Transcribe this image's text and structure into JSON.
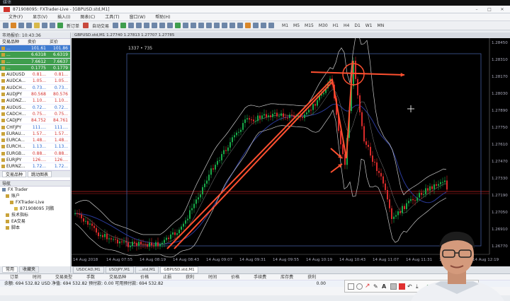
{
  "top_strip": {
    "label": "媒体"
  },
  "window": {
    "title": "871908095: FXTrader-Live - [GBPUSD.std,M1]",
    "minimize": "–",
    "maximize": "□",
    "close": "✕"
  },
  "menu": [
    "文件(F)",
    "显示(V)",
    "插入(I)",
    "图表(C)",
    "工具(T)",
    "窗口(W)",
    "帮助(H)"
  ],
  "toolbar": {
    "new_order": "新订单",
    "auto_trading": "自动交易"
  },
  "market_watch": {
    "title": "市场报价: 10:43:36",
    "col_symbol": "交易品种",
    "col_bid": "卖价",
    "col_ask": "买价",
    "rows": [
      {
        "symbol": "...",
        "bid": "101.61",
        "ask": "101.86",
        "style": "hl"
      },
      {
        "symbol": "...",
        "bid": "6.6318",
        "ask": "6.6319",
        "style": "gr"
      },
      {
        "symbol": "...",
        "bid": "7.6612",
        "ask": "7.6637",
        "style": "gr"
      },
      {
        "symbol": "...",
        "bid": "0.1775",
        "ask": "0.1779",
        "style": "gr"
      },
      {
        "symbol": "AUDUSD",
        "bid": "0.81...",
        "ask": "0.81...",
        "style": ""
      },
      {
        "symbol": "AUDCA...",
        "bid": "1.05...",
        "ask": "1.05...",
        "style": ""
      },
      {
        "symbol": "AUDCH...",
        "bid": "0.73...",
        "ask": "0.73...",
        "style": ""
      },
      {
        "symbol": "AUDJPY",
        "bid": "80.568",
        "ask": "80.576",
        "style": ""
      },
      {
        "symbol": "AUDNZ...",
        "bid": "1.10...",
        "ask": "1.10...",
        "style": ""
      },
      {
        "symbol": "AUDUS...",
        "bid": "0.72...",
        "ask": "0.72...",
        "style": ""
      },
      {
        "symbol": "CADCH...",
        "bid": "0.75...",
        "ask": "0.75...",
        "style": ""
      },
      {
        "symbol": "CADJPY",
        "bid": "84.752",
        "ask": "84.761",
        "style": ""
      },
      {
        "symbol": "CHFJPY",
        "bid": "111....",
        "ask": "111....",
        "style": ""
      },
      {
        "symbol": "EURAU...",
        "bid": "1.57...",
        "ask": "1.57...",
        "style": ""
      },
      {
        "symbol": "EURCA...",
        "bid": "1.48...",
        "ask": "1.48...",
        "style": ""
      },
      {
        "symbol": "EURCH...",
        "bid": "1.13...",
        "ask": "1.13...",
        "style": ""
      },
      {
        "symbol": "EURGB...",
        "bid": "0.88...",
        "ask": "0.88...",
        "style": ""
      },
      {
        "symbol": "EURJPY",
        "bid": "126....",
        "ask": "126....",
        "style": ""
      },
      {
        "symbol": "EURNZ...",
        "bid": "1.72...",
        "ask": "1.72...",
        "style": ""
      }
    ],
    "tab1": "交易品种",
    "tab2": "跳动图表"
  },
  "navigator": {
    "title": "导航",
    "items": [
      "FX Trader",
      "账户",
      "FXTrader-Live",
      "871908095 刘鹏",
      "技术指标",
      "EA交易",
      "脚本"
    ],
    "tab1": "常用",
    "tab2": "收藏夹"
  },
  "chart": {
    "title": "GBPUSD.std,M1  1.27740 1.27813 1.27707 1.27785",
    "measure_label": "1337 • 735",
    "x_ticks": [
      "14 Aug 2018",
      "14 Aug 07:55",
      "14 Aug 08:19",
      "14 Aug 08:43",
      "14 Aug 09:07",
      "14 Aug 09:31",
      "14 Aug 09:55",
      "14 Aug 10:19",
      "14 Aug 10:43",
      "14 Aug 11:07",
      "14 Aug 11:31",
      "14 Aug 11:55",
      "14 Aug 12:19"
    ],
    "y_ticks": [
      "1.28450",
      "1.28310",
      "1.28170",
      "1.28030",
      "1.27890",
      "1.27750",
      "1.27610",
      "1.27470",
      "1.27330",
      "1.27190",
      "1.27050",
      "1.26910",
      "1.26770"
    ],
    "colors": {
      "bull": "#18a848",
      "bear": "#d82a2a",
      "arrow": "#ff5030",
      "band": "#c8c8c8",
      "ma": "#2a3a9a",
      "level": "#c02020",
      "frame": "#4a66b0"
    }
  },
  "bottom_tabs": [
    "USDCAD,M1",
    "USDJPY,M1",
    "...std,M1",
    "GBPUSD.std,M1"
  ],
  "terminal": {
    "columns": [
      "订单",
      "时间",
      "交易类型",
      "手数",
      "交易品种",
      "价格",
      "止损",
      "获利",
      "时间",
      "价格",
      "手续费",
      "库存费",
      "获利"
    ],
    "balance": "余额: 694 532.82 USD  净值: 694 532.82  预付款: 0.00  可用预付款: 694 532.82",
    "profit": "0.00"
  },
  "draw_toolbar": {
    "finish": "完成"
  }
}
